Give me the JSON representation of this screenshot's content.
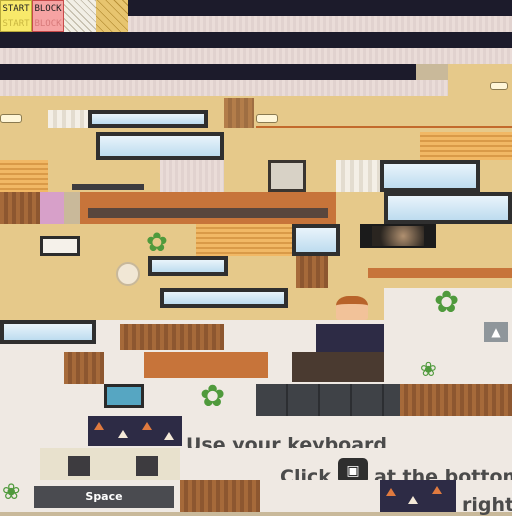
{
  "palette": {
    "start_tile": "#f8e96a",
    "block_tile": "#f6a3a3"
  },
  "tiles": {
    "start_label": "START",
    "start_label_faded": "START",
    "block_label": "BLOCK",
    "block_label_faded": "BLOCK"
  },
  "hints": {
    "keyboard_text": "Use your keyboard",
    "click_text_before": "Click",
    "click_text_after": "at the bottom",
    "right_fragment": "right"
  },
  "keys": {
    "space_label": "Space"
  }
}
